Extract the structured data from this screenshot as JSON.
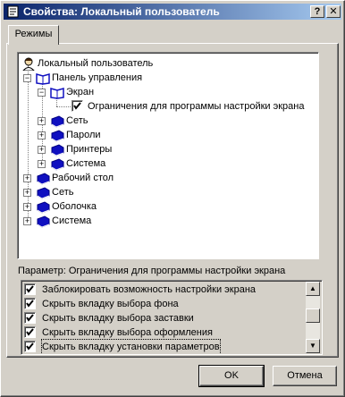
{
  "window": {
    "title": "Свойства: Локальный пользователь",
    "help_label": "?",
    "close_label": "✕"
  },
  "tabs": [
    {
      "label": "Режимы",
      "selected": true
    }
  ],
  "tree": {
    "root": {
      "label": "Локальный пользователь",
      "icon": "user-icon"
    },
    "control_panel": {
      "label": "Панель управления",
      "expanded": true
    },
    "screen": {
      "label": "Экран",
      "expanded": true
    },
    "screen_restrictions": {
      "label": "Ограничения для программы настройки экрана",
      "checked": true
    },
    "cp_children": [
      {
        "label": "Сеть"
      },
      {
        "label": "Пароли"
      },
      {
        "label": "Принтеры"
      },
      {
        "label": "Система"
      }
    ],
    "root_children": [
      {
        "label": "Рабочий стол"
      },
      {
        "label": "Сеть"
      },
      {
        "label": "Оболочка"
      },
      {
        "label": "Система"
      }
    ]
  },
  "parameter": {
    "label": "Параметр: Ограничения для программы настройки экрана",
    "items": [
      {
        "label": "Заблокировать возможность настройки экрана",
        "checked": true
      },
      {
        "label": "Скрыть вкладку выбора фона",
        "checked": true
      },
      {
        "label": "Скрыть вкладку выбора заставки",
        "checked": true
      },
      {
        "label": "Скрыть вкладку выбора оформления",
        "checked": true
      },
      {
        "label": "Скрыть вкладку установки параметров",
        "checked": true
      }
    ]
  },
  "buttons": {
    "ok": "OK",
    "cancel": "Отмена"
  },
  "colors": {
    "face": "#d4d0c8",
    "title_start": "#0a246a",
    "title_end": "#a6caf0",
    "book_blue": "#1010c0"
  }
}
